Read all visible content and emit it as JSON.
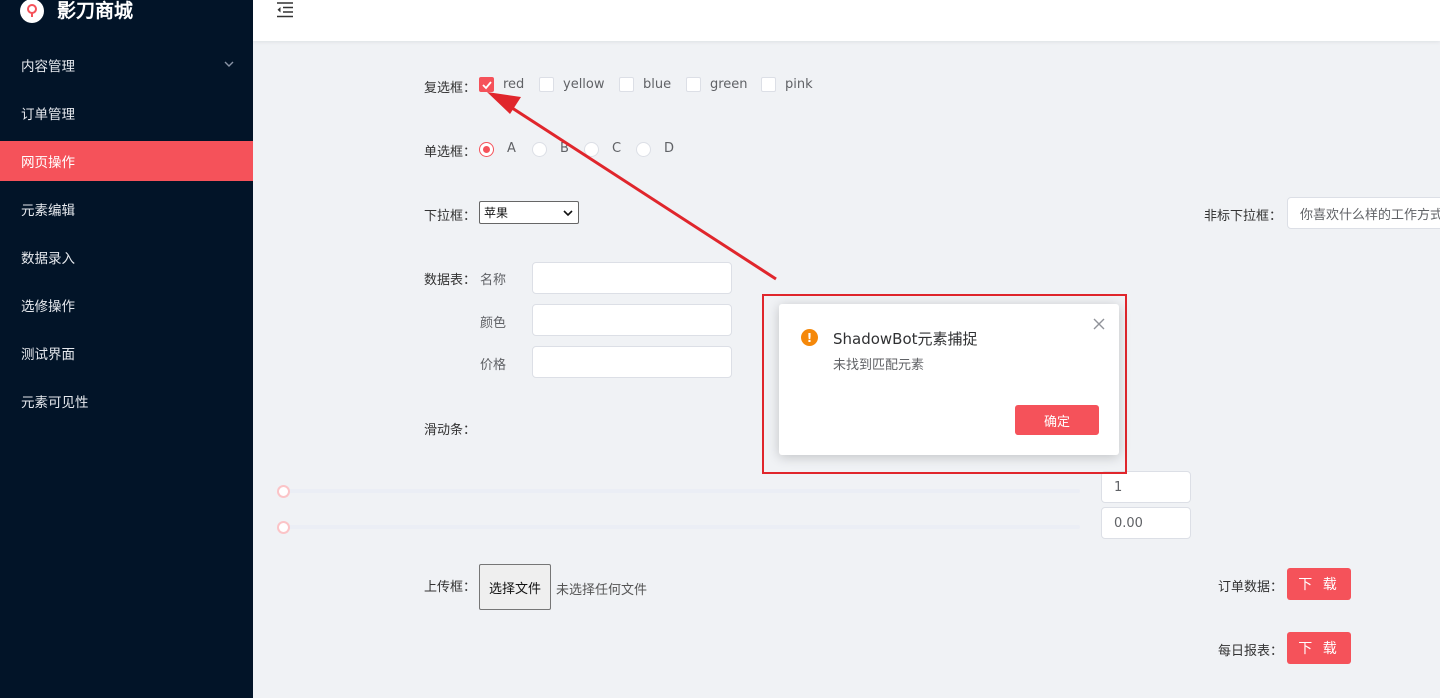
{
  "brand": {
    "title": "影刀商城",
    "logo_icon": "pin-logo-icon"
  },
  "sidebar": {
    "items": [
      {
        "label": "内容管理",
        "expandable": true
      },
      {
        "label": "订单管理"
      },
      {
        "label": "网页操作",
        "active": true
      },
      {
        "label": "元素编辑"
      },
      {
        "label": "数据录入"
      },
      {
        "label": "选修操作"
      },
      {
        "label": "测试界面"
      },
      {
        "label": "元素可见性"
      }
    ]
  },
  "form": {
    "checkbox": {
      "label": "复选框：",
      "options": [
        {
          "text": "red",
          "checked": true
        },
        {
          "text": "yellow",
          "checked": false
        },
        {
          "text": "blue",
          "checked": false
        },
        {
          "text": "green",
          "checked": false
        },
        {
          "text": "pink",
          "checked": false
        }
      ]
    },
    "radio": {
      "label": "单选框：",
      "options": [
        {
          "text": "A",
          "checked": true
        },
        {
          "text": "B",
          "checked": false
        },
        {
          "text": "C",
          "checked": false
        },
        {
          "text": "D",
          "checked": false
        }
      ]
    },
    "select": {
      "label": "下拉框：",
      "value": "苹果"
    },
    "fancy_select": {
      "label": "非标下拉框：",
      "placeholder": "你喜欢什么样的工作方式"
    },
    "table": {
      "label": "数据表：",
      "fields": [
        {
          "label": "名称",
          "value": ""
        },
        {
          "label": "颜色",
          "value": ""
        },
        {
          "label": "价格",
          "value": ""
        }
      ]
    },
    "slider": {
      "label": "滑动条：",
      "values": [
        "1",
        "0.00"
      ]
    },
    "upload": {
      "label": "上传框：",
      "button": "选择文件",
      "status": "未选择任何文件"
    },
    "downloads": [
      {
        "label": "订单数据：",
        "button": "下 载"
      },
      {
        "label": "每日报表：",
        "button": "下 载"
      }
    ]
  },
  "dialog": {
    "title": "ShadowBot元素捕捉",
    "message": "未找到匹配元素",
    "ok_button": "确定"
  },
  "colors": {
    "accent": "#f5525a",
    "sidebar_bg": "#021428",
    "annotation": "#e0262c",
    "warning": "#f5880a"
  }
}
